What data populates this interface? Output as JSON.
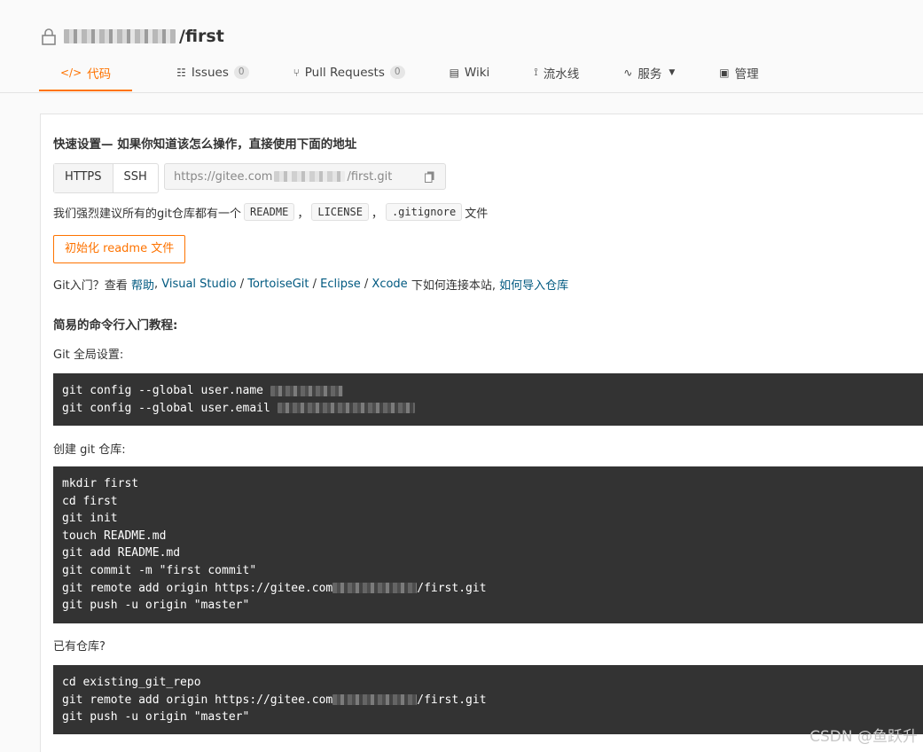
{
  "repo": {
    "name": "/first"
  },
  "tabs": [
    {
      "label": "代码",
      "icon": "code-icon"
    },
    {
      "label": "Issues",
      "icon": "issues-icon",
      "badge": "0"
    },
    {
      "label": "Pull Requests",
      "icon": "pull-request-icon",
      "badge": "0"
    },
    {
      "label": "Wiki",
      "icon": "wiki-icon"
    },
    {
      "label": "流水线",
      "icon": "pipeline-icon"
    },
    {
      "label": "服务",
      "icon": "service-icon"
    },
    {
      "label": "管理",
      "icon": "manage-icon"
    }
  ],
  "quick": {
    "title": "快速设置— 如果你知道该怎么操作，直接使用下面的地址",
    "https": "HTTPS",
    "ssh": "SSH",
    "url_prefix": "https://gitee.com",
    "url_suffix": "/first.git",
    "recommend_prefix": "我们强烈建议所有的git仓库都有一个",
    "readme": "README",
    "license": "LICENSE",
    "gitignore": ".gitignore",
    "recommend_suffix": "文件",
    "comma": "，",
    "init_button": "初始化 readme 文件",
    "help_prefix": "Git入门？查看",
    "help_link": "帮助",
    "vs": "Visual Studio",
    "tortoise": "TortoiseGit",
    "eclipse": "Eclipse",
    "xcode": "Xcode",
    "help_mid": "下如何连接本站,",
    "import_link": "如何导入仓库",
    "sep": " / ",
    "comma2": " ,"
  },
  "tutorial": {
    "title": "简易的命令行入门教程:",
    "global_label": "Git 全局设置:",
    "global_lines": [
      "git config --global user.name ",
      "git config --global user.email "
    ],
    "create_label": "创建 git 仓库:",
    "create_lines": [
      "mkdir first",
      "cd first",
      "git init",
      "touch README.md",
      "git add README.md",
      "git commit -m \"first commit\"",
      "git remote add origin https://gitee.com",
      "git push -u origin \"master\""
    ],
    "remote_suffix": "/first.git",
    "existing_label": "已有仓库?",
    "existing_lines": [
      "cd existing_git_repo",
      "git remote add origin https://gitee.com",
      "git push -u origin \"master\""
    ]
  },
  "watermark": "CSDN @鱼跃升",
  "colors": {
    "accent": "#fe7300",
    "link": "#005980",
    "code_bg": "#333333"
  }
}
